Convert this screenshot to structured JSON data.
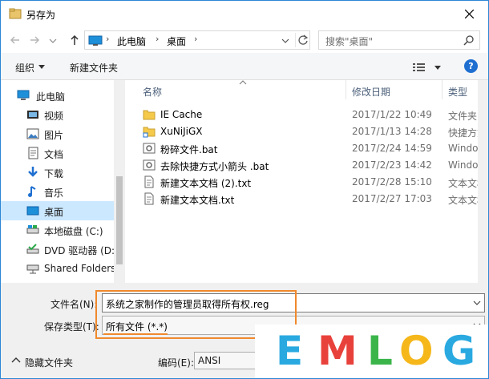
{
  "window": {
    "title": "另存为"
  },
  "address": {
    "path": [
      "此电脑",
      "桌面"
    ],
    "search_placeholder": "搜索\"桌面\""
  },
  "toolbar": {
    "organize": "组织",
    "new_folder": "新建文件夹",
    "help": "?"
  },
  "sidebar": {
    "items": [
      {
        "label": "此电脑",
        "icon": "computer-icon"
      },
      {
        "label": "视频",
        "icon": "video-folder-icon"
      },
      {
        "label": "图片",
        "icon": "pictures-folder-icon"
      },
      {
        "label": "文档",
        "icon": "documents-folder-icon"
      },
      {
        "label": "下载",
        "icon": "download-icon"
      },
      {
        "label": "音乐",
        "icon": "music-icon"
      },
      {
        "label": "桌面",
        "icon": "desktop-icon",
        "selected": true
      },
      {
        "label": "本地磁盘 (C:)",
        "icon": "drive-icon"
      },
      {
        "label": "DVD 驱动器 (D:",
        "icon": "dvd-drive-icon"
      },
      {
        "label": "Shared Folders",
        "icon": "network-drive-icon"
      }
    ]
  },
  "file_list": {
    "columns": {
      "name": "名称",
      "modified": "修改日期",
      "type": "类型"
    },
    "rows": [
      {
        "name": "IE Cache",
        "modified": "2017/1/22 10:49",
        "type": "文件夹",
        "icon": "folder-icon"
      },
      {
        "name": "XuNiJiGX",
        "modified": "2017/1/13 14:28",
        "type": "快捷方式",
        "icon": "folder-shortcut-icon"
      },
      {
        "name": "粉碎文件.bat",
        "modified": "2017/2/24 14:59",
        "type": "Windows",
        "icon": "batch-file-icon"
      },
      {
        "name": "去除快捷方式小箭头 .bat",
        "modified": "2017/2/23 14:42",
        "type": "Windows",
        "icon": "batch-file-icon"
      },
      {
        "name": "新建文本文档 (2).txt",
        "modified": "2017/2/28 15:10",
        "type": "文本文档",
        "icon": "text-file-icon"
      },
      {
        "name": "新建文本文档.txt",
        "modified": "2017/2/27 17:03",
        "type": "文本文档",
        "icon": "text-file-icon"
      }
    ]
  },
  "form": {
    "filename_label": "文件名(N):",
    "filename_value": "系统之家制作的管理员取得所有权.reg",
    "filetype_label": "保存类型(T):",
    "filetype_value": "所有文件  (*.*)",
    "hide_folders": "隐藏文件夹",
    "encoding_label": "编码(E):",
    "encoding_value": "ANSI"
  },
  "watermark": {
    "letters": [
      "E",
      "M",
      "L",
      "O",
      "G"
    ],
    "colors": [
      "#29a9e0",
      "#e8413b",
      "#3bb54a",
      "#f5b71a",
      "#29a9e0"
    ]
  },
  "colors": {
    "accent": "#2b86d6",
    "highlight": "#f0892d",
    "selection": "#cce8ff"
  }
}
